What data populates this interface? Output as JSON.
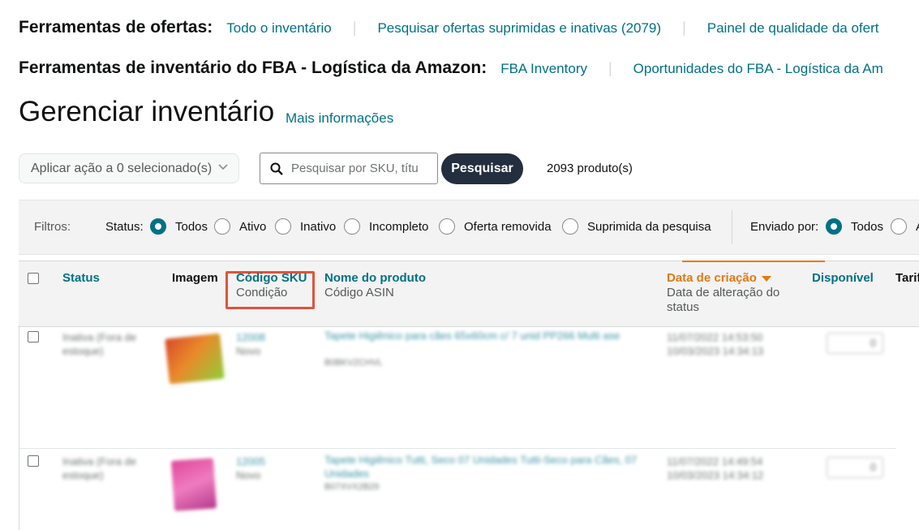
{
  "toolbar_offers": {
    "title": "Ferramentas de ofertas:",
    "links": [
      "Todo o inventário",
      "Pesquisar ofertas suprimidas e inativas (2079)",
      "Painel de qualidade da ofert"
    ]
  },
  "toolbar_fba": {
    "title": "Ferramentas de inventário do FBA - Logística da Amazon:",
    "links": [
      "FBA Inventory",
      "Oportunidades do FBA - Logística da Am"
    ]
  },
  "page": {
    "title": "Gerenciar inventário",
    "more_info": "Mais informações"
  },
  "actions": {
    "apply_label": "Aplicar ação a 0 selecionado(s)",
    "search_placeholder": "Pesquisar por SKU, títu",
    "search_button": "Pesquisar",
    "product_count": "2093 produto(s)"
  },
  "filters": {
    "label": "Filtros:",
    "status_label": "Status:",
    "status_options": [
      "Todos",
      "Ativo",
      "Inativo",
      "Incompleto",
      "Oferta removida",
      "Suprimida da pesquisa"
    ],
    "status_selected": "Todos",
    "shipped_label": "Enviado por:",
    "shipped_options": [
      "Todos",
      "A"
    ],
    "shipped_selected": "Todos"
  },
  "columns": {
    "status": "Status",
    "image": "Imagem",
    "sku": "Código SKU",
    "condition": "Condição",
    "product_name": "Nome do produto",
    "asin": "Código ASIN",
    "created": "Data de criação",
    "modified": "Data de alteração do status",
    "available": "Disponível",
    "tariff": "Tarif"
  },
  "rows": [
    {
      "status": "Inativa (Fora de estoque)",
      "sku": "12008",
      "condition": "Novo",
      "name": "Tapete Higiênico para cães 65x60cm c/ 7 unid PP266 Multi ase",
      "asin": "B0BKVZCHVL",
      "created": "11/07/2022 14:53:50",
      "modified": "10/03/2023 14:34:13",
      "available": "0",
      "thumb_colors": [
        "#d74a2a",
        "#8fce3a"
      ]
    },
    {
      "status": "Inativa (Fora de estoque)",
      "sku": "12005",
      "condition": "Novo",
      "name": "Tapete Higiênico Tutti, Seco 07 Unidades Tutti-Seco para Cães, 07 Unidades",
      "asin": "B07XVX2B29",
      "created": "11/07/2022 14:49:54",
      "modified": "10/03/2023 14:34:12",
      "available": "0",
      "thumb_colors": [
        "#e0489a",
        "#b43a8a"
      ]
    }
  ],
  "colors": {
    "link": "#007185",
    "sort_accent": "#e47911",
    "highlight": "#e0533b",
    "button_dark": "#232f3e"
  }
}
